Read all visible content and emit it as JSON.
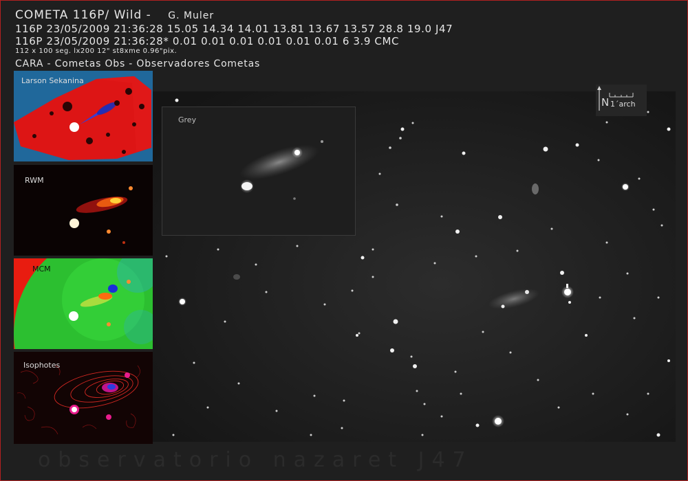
{
  "header": {
    "title": "COMETA 116P/  Wild -",
    "author": "G. Muler",
    "line1": "116P 23/05/2009 21:36:28 15.05 14.34 14.01 13.81 13.67 13.57 28.8 19.0 J47",
    "line2": "116P 23/05/2009 21:36:28* 0.01 0.01 0.01 0.01 0.01 0.01 6 3.9 CMC",
    "exposure": "112 x 100 seg. lx200 12\" st8xme 0.96\"pix.",
    "org": "CARA - Cometas Obs - Observadores Cometas"
  },
  "panels": [
    {
      "label": "Larson Sekanina"
    },
    {
      "label": "RWM"
    },
    {
      "label": "MCM"
    },
    {
      "label": "Isophotes"
    }
  ],
  "inset": {
    "label": "Grey"
  },
  "compass": {
    "north": "N",
    "scale": "1´arch"
  },
  "footer": {
    "text": "observatorio nazaret J47"
  },
  "colors": {
    "frame": "#b32020",
    "background": "#1f1f1f",
    "field": "#141414"
  }
}
